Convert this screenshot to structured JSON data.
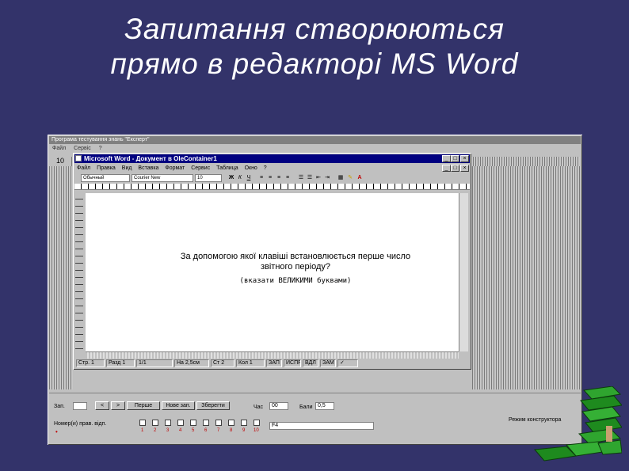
{
  "slide": {
    "title_line1": "Запитання створюються",
    "title_line2": "прямо в редакторі MS Word"
  },
  "app": {
    "title": "Програма тестування знань \"Експерт\"",
    "menu": [
      "Файл",
      "Сервіс",
      "?"
    ],
    "question_no": "10"
  },
  "word": {
    "title": "Microsoft Word - Документ в OleContainer1",
    "menu": [
      "Файл",
      "Правка",
      "Вид",
      "Вставка",
      "Формат",
      "Сервис",
      "Таблица",
      "Окно",
      "?"
    ],
    "style_box": "Обычный",
    "font_box": "Courier New",
    "size_box": "10",
    "question_line1": "За допомогою якої клавіші встановлюється перше число",
    "question_line2": "звітного періоду?",
    "hint": "(вказати ВЕЛИКИМИ буквами)",
    "status": {
      "page": "Стр. 1",
      "section": "Разд 1",
      "pages": "1/1",
      "position": "На 2,5см",
      "line": "Ст 2",
      "column": "Кол 1",
      "rec": "ЗАП",
      "trk": "ИСПР",
      "ext": "ВДЛ",
      "ovr": "ЗАМ"
    }
  },
  "panel": {
    "question_label": "Зап.",
    "question_value": "",
    "prev_label": "<",
    "next_label": ">",
    "first_label": "Перше",
    "new_label": "Нове зап.",
    "save_label": "Зберегти",
    "time_label": "Час",
    "time_value": "00",
    "score_label": "Бали",
    "score_value": "0,5",
    "correct_label": "Номер(и) прав. відп.",
    "answer_value": "F4",
    "builder_label": "Режим конструктора",
    "checkbox_numbers": [
      "1",
      "2",
      "3",
      "4",
      "5",
      "6",
      "7",
      "8",
      "9",
      "10"
    ]
  }
}
